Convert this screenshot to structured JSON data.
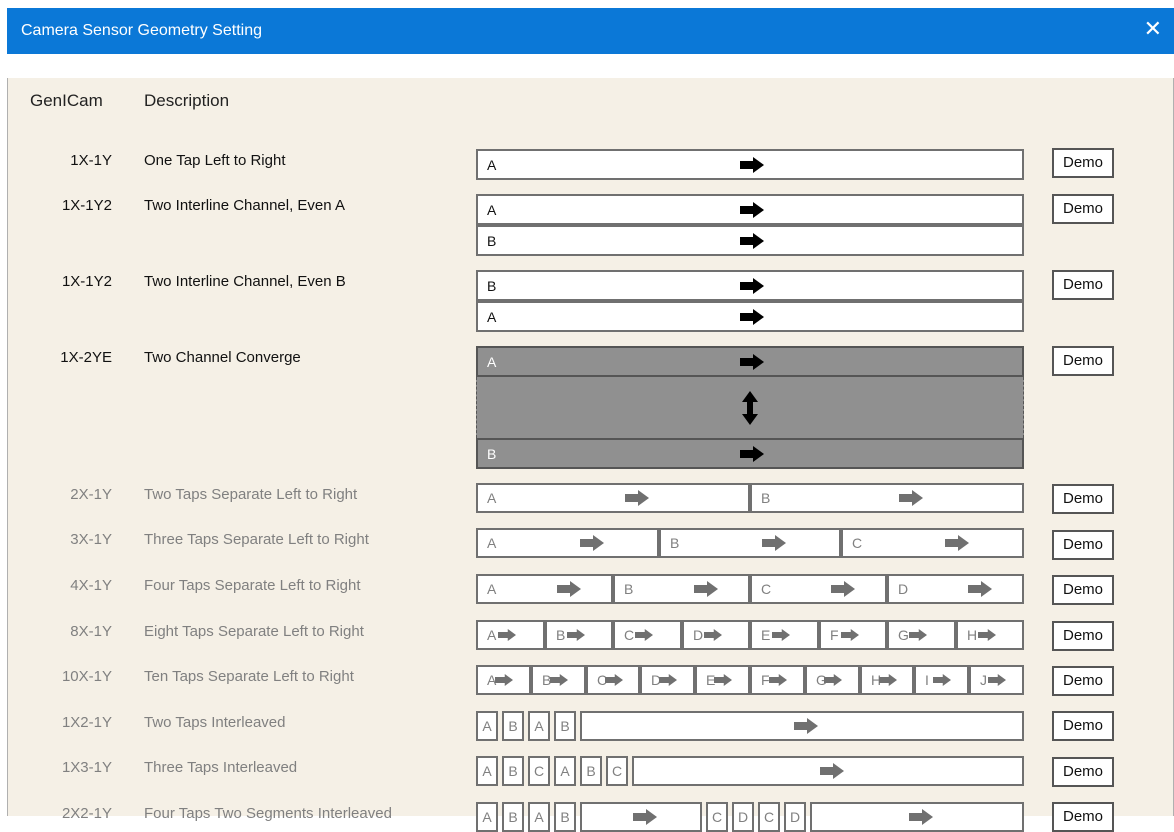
{
  "window": {
    "title": "Camera Sensor Geometry Setting"
  },
  "headers": {
    "genicam": "GenICam",
    "description": "Description"
  },
  "demo_label": "Demo",
  "rows": [
    {
      "code": "1X-1Y",
      "desc": "One Tap Left to Right",
      "enabled": true,
      "taps": [
        "A"
      ]
    },
    {
      "code": "1X-1Y2",
      "desc": "Two Interline Channel, Even A",
      "enabled": true,
      "taps": [
        "A",
        "B"
      ]
    },
    {
      "code": "1X-1Y2",
      "desc": "Two Interline Channel, Even B",
      "enabled": true,
      "taps": [
        "B",
        "A"
      ]
    },
    {
      "code": "1X-2YE",
      "desc": "Two Channel Converge",
      "enabled": true,
      "taps": [
        "A",
        "B"
      ]
    },
    {
      "code": "2X-1Y",
      "desc": "Two Taps Separate Left to Right",
      "enabled": false,
      "taps": [
        "A",
        "B"
      ]
    },
    {
      "code": "3X-1Y",
      "desc": "Three Taps Separate Left to Right",
      "enabled": false,
      "taps": [
        "A",
        "B",
        "C"
      ]
    },
    {
      "code": "4X-1Y",
      "desc": "Four Taps Separate Left to Right",
      "enabled": false,
      "taps": [
        "A",
        "B",
        "C",
        "D"
      ]
    },
    {
      "code": "8X-1Y",
      "desc": "Eight Taps Separate Left to Right",
      "enabled": false,
      "taps": [
        "A",
        "B",
        "C",
        "D",
        "E",
        "F",
        "G",
        "H"
      ]
    },
    {
      "code": "10X-1Y",
      "desc": "Ten Taps Separate Left to Right",
      "enabled": false,
      "taps": [
        "A",
        "B",
        "C",
        "D",
        "E",
        "F",
        "G",
        "H",
        "I",
        "J"
      ]
    },
    {
      "code": "1X2-1Y",
      "desc": "Two Taps Interleaved",
      "enabled": false,
      "taps": [
        "A",
        "B",
        "A",
        "B"
      ]
    },
    {
      "code": "1X3-1Y",
      "desc": "Three Taps Interleaved",
      "enabled": false,
      "taps": [
        "A",
        "B",
        "C",
        "A",
        "B",
        "C"
      ]
    },
    {
      "code": "2X2-1Y",
      "desc": "Four Taps Two Segments Interleaved",
      "enabled": false,
      "taps": [
        "A",
        "B",
        "A",
        "B",
        "C",
        "D",
        "C",
        "D"
      ]
    }
  ],
  "colors": {
    "titlebar": "#0b78d7",
    "panel": "#f5f0e6",
    "enabled_text": "#111111",
    "disabled_text": "#808080",
    "converge_fill": "#909090"
  },
  "icons": [
    "close-icon",
    "right-arrow-icon",
    "up-down-arrow-icon"
  ]
}
